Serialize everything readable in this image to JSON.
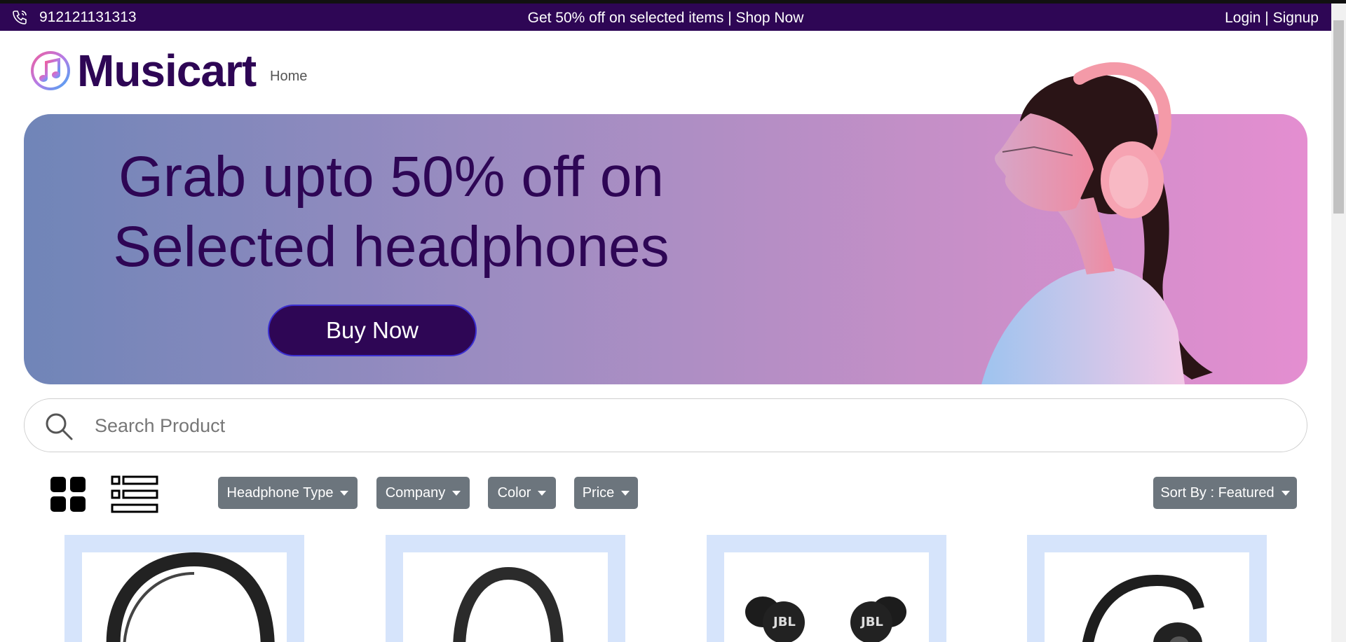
{
  "topbar": {
    "phone": "912121131313",
    "promo": "Get 50% off on selected items | Shop Now",
    "auth": "Login | Signup"
  },
  "header": {
    "brand": "Musicart",
    "nav_home": "Home"
  },
  "hero": {
    "line1": "Grab upto 50% off on",
    "line2": "Selected headphones",
    "button": "Buy Now"
  },
  "search": {
    "placeholder": "Search Product"
  },
  "filters": {
    "headphone_type": "Headphone Type",
    "company": "Company",
    "color": "Color",
    "price": "Price",
    "sort": "Sort By : Featured"
  },
  "products": [
    {
      "icon": "over-ear-headphones"
    },
    {
      "icon": "on-ear-headphones"
    },
    {
      "icon": "jbl-earbuds"
    },
    {
      "icon": "headphones"
    }
  ],
  "colors": {
    "brand": "#2e0655",
    "filter_button": "#6c757d",
    "card_bg": "#d6e4fb"
  }
}
